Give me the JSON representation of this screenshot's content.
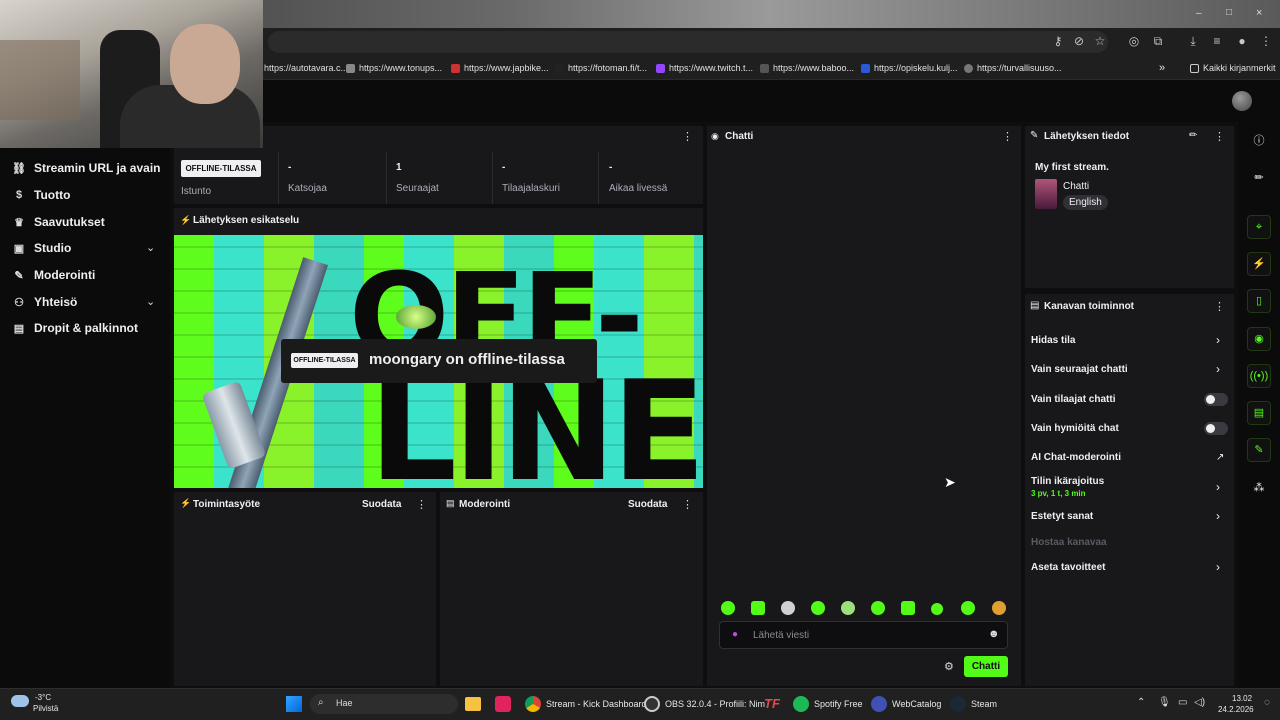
{
  "bookmarks": [
    "https://autotavara.c...",
    "https://www.tonups...",
    "https://www.japbike...",
    "https://fotoman.fi/t...",
    "https://www.twitch.t...",
    "https://www.baboo...",
    "https://opiskelu.kulj...",
    "https://turvallisuuso...",
    "Kaikki kirjanmerkit"
  ],
  "nav": {
    "items": [
      "Streamin URL ja avain",
      "Tuotto",
      "Saavutukset",
      "Studio",
      "Moderointi",
      "Yhteisö",
      "Dropit & palkinnot"
    ]
  },
  "session": {
    "badge": "OFFLINE-TILASSA",
    "label": "Istunto",
    "stats": [
      {
        "value": "-",
        "label": "Katsojaa"
      },
      {
        "value": "1",
        "label": "Seuraajat"
      },
      {
        "value": "-",
        "label": "Tilaajalaskuri"
      },
      {
        "value": "-",
        "label": "Aikaa livessä"
      }
    ]
  },
  "preview": {
    "title": "Lähetyksen esikatselu",
    "art_line1": "OFF-",
    "art_line2": "LINE",
    "overlay_badge": "OFFLINE-TILASSA",
    "overlay_text": "moongary on offline-tilassa"
  },
  "activity": {
    "title": "Toimintasyöte",
    "filter": "Suodata"
  },
  "moderation": {
    "title": "Moderointi",
    "filter": "Suodata"
  },
  "chat": {
    "title": "Chatti",
    "placeholder": "Lähetä viesti",
    "send": "Chatti"
  },
  "stream_info": {
    "title": "Lähetyksen tiedot",
    "stream_title": "My first stream.",
    "category": "Chatti",
    "language": "English"
  },
  "channel_actions": {
    "title": "Kanavan toiminnot",
    "slow_mode": "Hidas tila",
    "followers_only": "Vain seuraajat chatti",
    "subscribers_only": "Vain tilaajat chatti",
    "emotes_only": "Vain hymiöitä chat",
    "ai_moderation": "AI Chat-moderointi",
    "account_age": "Tilin ikärajoitus",
    "account_age_value": "3 pv, 1 t, 3 min",
    "banned_words": "Estetyt sanat",
    "host_channel": "Hostaa kanavaa",
    "set_goals": "Aseta tavoitteet"
  },
  "taskbar": {
    "weather_temp": "-3°C",
    "weather_desc": "Pilvistä",
    "search": "Hae",
    "apps": [
      "Stream - Kick Dashboard",
      "OBS 32.0.4 - Profiili: Nim",
      "Spotify Free",
      "WebCatalog",
      "Steam"
    ],
    "time": "13.02",
    "date": "24.2.2026"
  },
  "colors": {
    "accent": "#53fc18",
    "panel": "#18181b",
    "background": "#0e0e10"
  }
}
